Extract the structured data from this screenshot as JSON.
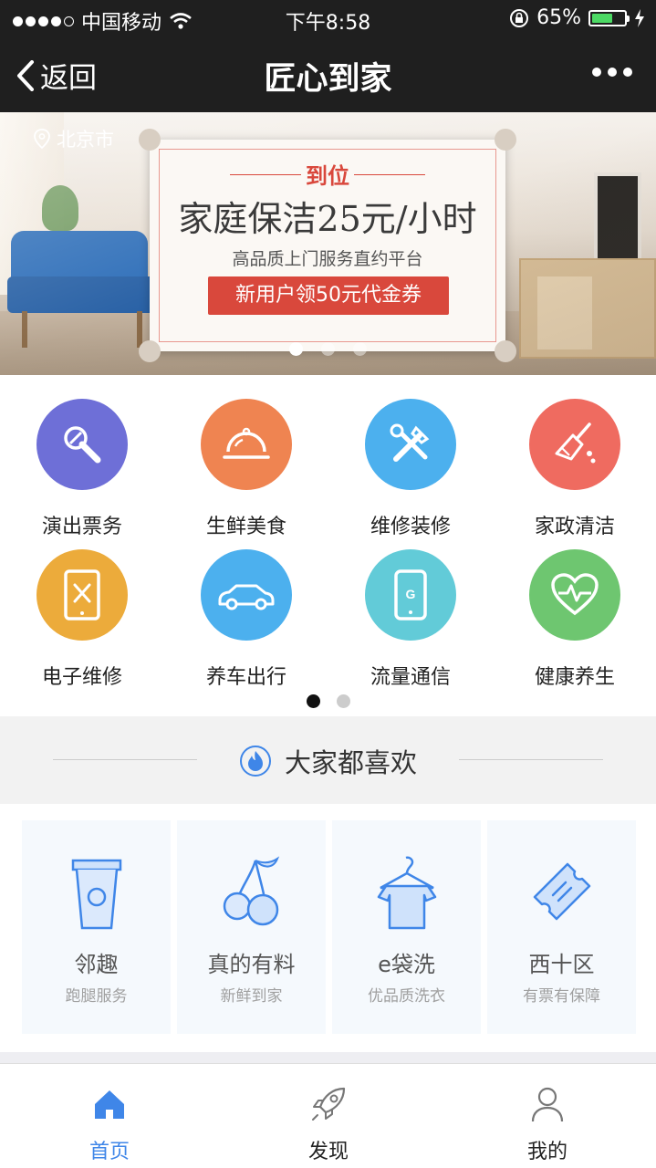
{
  "status_bar": {
    "carrier": "中国移动",
    "time": "下午8:58",
    "battery_percent": "65%",
    "battery_level": 0.65
  },
  "nav": {
    "back_label": "返回",
    "title": "匠心到家"
  },
  "banner": {
    "location": "北京市",
    "tag": "到位",
    "headline": "家庭保洁25元/小时",
    "subtitle": "高品质上门服务直约平台",
    "cta": "新用户领50元代金券",
    "page_count": 3,
    "active_page": 1
  },
  "categories": {
    "items": [
      {
        "label": "演出票务",
        "icon": "microphone-icon",
        "color": "#6e6fd7"
      },
      {
        "label": "生鲜美食",
        "icon": "food-cloche-icon",
        "color": "#ef8451"
      },
      {
        "label": "维修装修",
        "icon": "tools-icon",
        "color": "#4cb0ee"
      },
      {
        "label": "家政清洁",
        "icon": "broom-icon",
        "color": "#ef6b60"
      },
      {
        "label": "电子维修",
        "icon": "tablet-repair-icon",
        "color": "#ecab3b"
      },
      {
        "label": "养车出行",
        "icon": "car-icon",
        "color": "#4cb0ee"
      },
      {
        "label": "流量通信",
        "icon": "phone-icon",
        "color": "#62cbd8"
      },
      {
        "label": "健康养生",
        "icon": "heart-pulse-icon",
        "color": "#6ec670"
      }
    ],
    "page_count": 2,
    "active_page": 1
  },
  "popular": {
    "title": "大家都喜欢",
    "items": [
      {
        "title": "邻趣",
        "subtitle": "跑腿服务",
        "icon": "cup-icon"
      },
      {
        "title": "真的有料",
        "subtitle": "新鲜到家",
        "icon": "cherries-icon"
      },
      {
        "title": "e袋洗",
        "subtitle": "优品质洗衣",
        "icon": "shirt-hanger-icon"
      },
      {
        "title": "西十区",
        "subtitle": "有票有保障",
        "icon": "ticket-icon"
      }
    ]
  },
  "tabbar": {
    "items": [
      {
        "label": "首页",
        "icon": "home-icon",
        "active": true
      },
      {
        "label": "发现",
        "icon": "rocket-icon",
        "active": false
      },
      {
        "label": "我的",
        "icon": "user-icon",
        "active": false
      }
    ]
  },
  "colors": {
    "accent_blue": "#3f86e8",
    "coupon_red": "#d9483c",
    "nav_bg": "#1f1f1f"
  }
}
